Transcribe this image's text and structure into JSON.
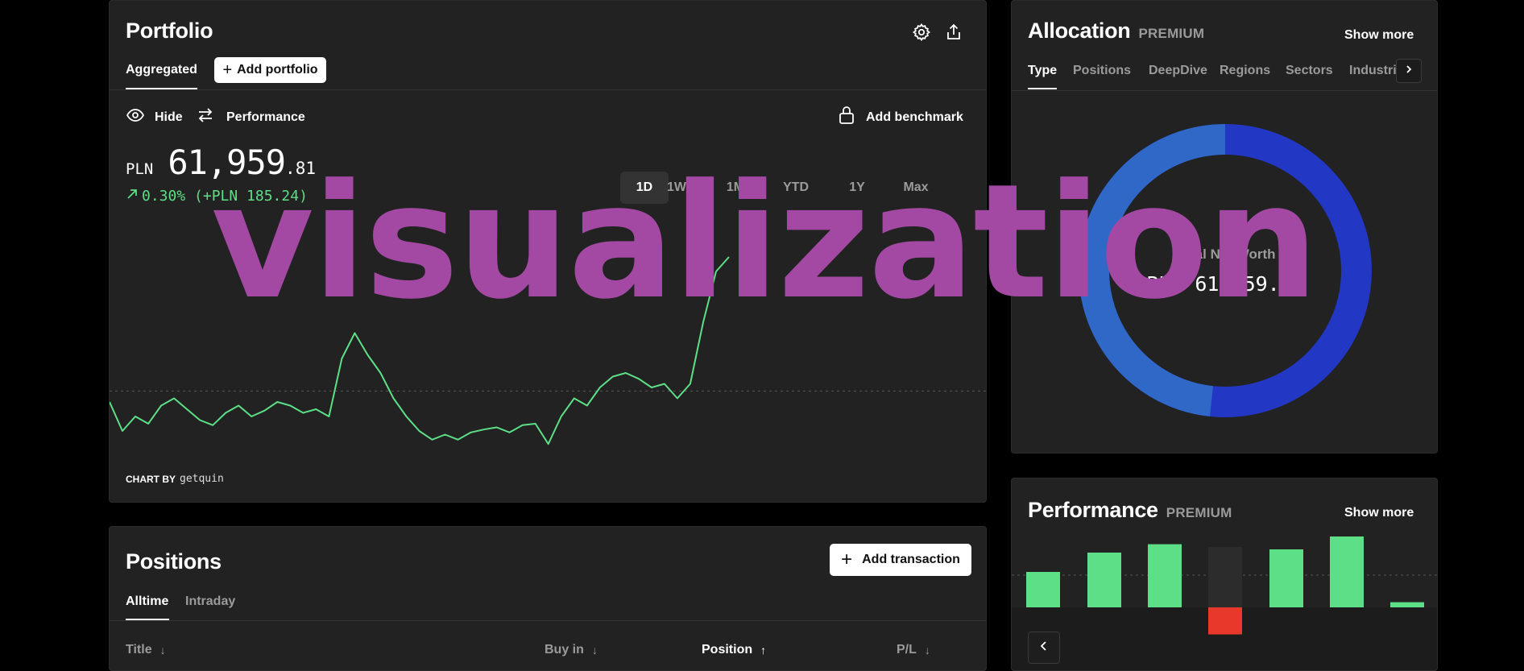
{
  "portfolio": {
    "title": "Portfolio",
    "tab_aggregated": "Aggregated",
    "add_portfolio": "Add portfolio",
    "hide": "Hide",
    "performance": "Performance",
    "add_benchmark": "Add benchmark",
    "currency": "PLN",
    "value_main": "61,959",
    "value_decimals": ".81",
    "change": "0.30% (+PLN 185.24)",
    "ranges": [
      "1D",
      "1W",
      "1M",
      "YTD",
      "1Y",
      "Max"
    ],
    "active_range": "1D",
    "chart_by_label": "CHART BY",
    "chart_by_brand": "getquin",
    "line_color": "#5ddf87"
  },
  "allocation": {
    "title": "Allocation",
    "premium": "PREMIUM",
    "show_more": "Show more",
    "tabs": [
      "Type",
      "Positions",
      "DeepDive",
      "Regions",
      "Sectors",
      "Industries"
    ],
    "active_tab": "Type",
    "center_label": "Total Net Worth",
    "center_value": "PLN 61,959.81",
    "donut_colors": [
      "#2238c4",
      "#3068c8"
    ]
  },
  "performance_card": {
    "title": "Performance",
    "premium": "PREMIUM",
    "show_more": "Show more"
  },
  "positions": {
    "title": "Positions",
    "add_transaction": "Add transaction",
    "tab_alltime": "Alltime",
    "tab_intraday": "Intraday",
    "col_title": "Title",
    "col_buyin": "Buy in",
    "col_position": "Position",
    "col_pl": "P/L"
  },
  "watermark": "visualization",
  "chart_data": {
    "type": "line",
    "title": "",
    "xlabel": "",
    "ylabel": "",
    "series": [
      {
        "values": [
          61900,
          61860,
          61880,
          61870,
          61895,
          61905,
          61890,
          61875,
          61868,
          61885,
          61895,
          61880,
          61888,
          61900,
          61895,
          61885,
          61890,
          61880,
          61960,
          61995,
          61965,
          61940,
          61905,
          61880,
          61860,
          61848,
          61855,
          61848,
          61858,
          61862,
          61865,
          61858,
          61868,
          61870,
          61842,
          61880,
          61905,
          61895,
          61920,
          61935,
          61940,
          61932,
          61920,
          61925,
          61905,
          61925,
          62010,
          62080,
          62100
        ]
      }
    ],
    "baseline": 61915,
    "ylim": [
      61820,
      62120
    ]
  },
  "bar_chart": {
    "type": "bar",
    "values": [
      0.55,
      0.85,
      0.98,
      -0.42,
      0.9,
      1.1,
      0.08
    ],
    "colors": {
      "positive": "#5ddf87",
      "negative": "#e8382c"
    }
  }
}
